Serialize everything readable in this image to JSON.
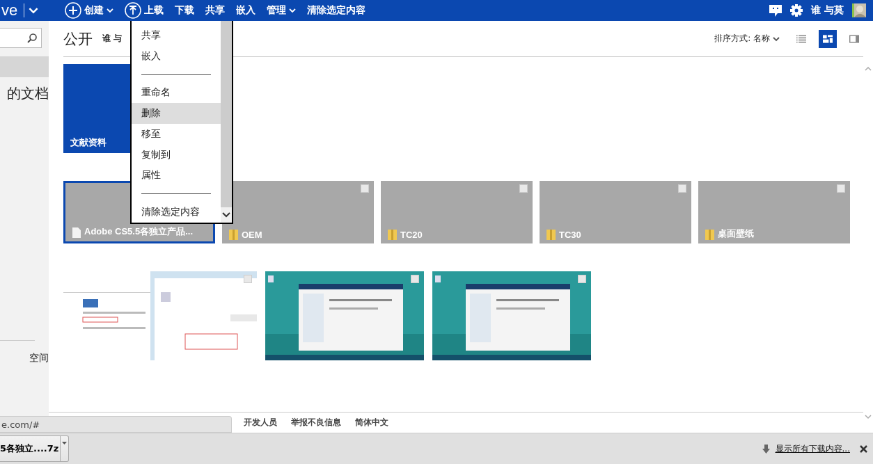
{
  "topbar": {
    "logo": "ve",
    "commands": [
      {
        "label": "创建",
        "kind": "create",
        "caret": true
      },
      {
        "label": "上载",
        "kind": "upload",
        "caret": false
      },
      {
        "label": "下载",
        "kind": "plain",
        "caret": false
      },
      {
        "label": "共享",
        "kind": "plain",
        "caret": false
      },
      {
        "label": "嵌入",
        "kind": "plain",
        "caret": false
      },
      {
        "label": "管理",
        "kind": "plain",
        "caret": true
      },
      {
        "label": "清除选定内容",
        "kind": "plain",
        "caret": false
      }
    ],
    "user": "谁 与莫"
  },
  "sidebar": {
    "items": [
      {
        "label": "的文档",
        "selected": false
      },
      {
        "label": "空间",
        "selected": false
      }
    ]
  },
  "header": {
    "title": "公开",
    "owner": "谁 与",
    "sort": "排序方式: 名称",
    "views": [
      {
        "kind": "list",
        "selected": false
      },
      {
        "kind": "tiles",
        "selected": true
      },
      {
        "kind": "details",
        "selected": false
      }
    ]
  },
  "menu": {
    "items": [
      {
        "kind": "item",
        "label": "共享",
        "selected": false
      },
      {
        "kind": "item",
        "label": "嵌入",
        "selected": false
      },
      {
        "kind": "separator"
      },
      {
        "kind": "item",
        "label": "重命名",
        "selected": false
      },
      {
        "kind": "item",
        "label": "删除",
        "selected": true
      },
      {
        "kind": "item",
        "label": "移至",
        "selected": false
      },
      {
        "kind": "item",
        "label": "复制到",
        "selected": false
      },
      {
        "kind": "item",
        "label": "属性",
        "selected": false
      },
      {
        "kind": "separator"
      },
      {
        "kind": "item",
        "label": "清除选定内容",
        "selected": false
      }
    ]
  },
  "groups": [
    {
      "kind": "featured",
      "tiles": [
        {
          "label": "文献资料"
        }
      ]
    },
    {
      "kind": "files",
      "tiles": [
        {
          "label": "Adobe CS5.5各独立产品...",
          "kind": "file",
          "selected": true
        },
        {
          "label": "OEM",
          "kind": "folder",
          "selected": false,
          "checked": false
        },
        {
          "label": "TC20",
          "kind": "folder",
          "selected": false,
          "checked": false
        },
        {
          "label": "TC30",
          "kind": "folder",
          "selected": false,
          "checked": false
        },
        {
          "label": "桌面壁纸",
          "kind": "folder",
          "selected": false,
          "checked": false
        }
      ]
    },
    {
      "kind": "pictures"
    }
  ],
  "footer": {
    "links": [
      "开发人员",
      "举报不良信息",
      "简体中文"
    ]
  },
  "status_url": "e.com/#",
  "downloads": {
    "file": "5各独立....7z",
    "show_all": "显示所有下载内容..."
  }
}
